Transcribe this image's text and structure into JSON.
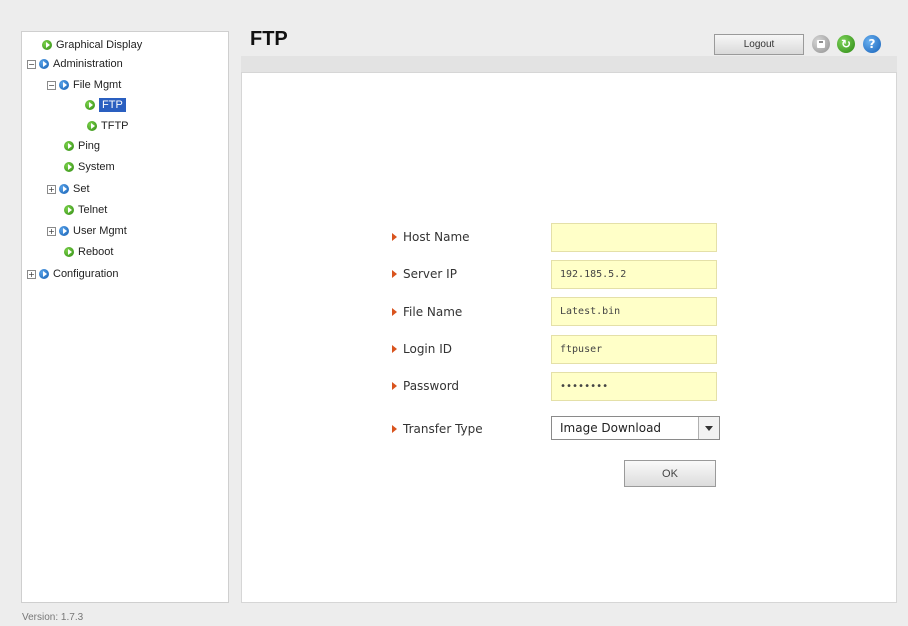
{
  "sidebar": {
    "items": [
      {
        "label": "Graphical Display",
        "toggle": "",
        "color": "green",
        "selected": false
      },
      {
        "label": "Administration",
        "toggle": "−",
        "color": "blue",
        "selected": false
      },
      {
        "label": "File Mgmt",
        "toggle": "−",
        "color": "blue",
        "selected": false
      },
      {
        "label": "FTP",
        "toggle": "",
        "color": "green",
        "selected": true
      },
      {
        "label": "TFTP",
        "toggle": "",
        "color": "green",
        "selected": false
      },
      {
        "label": "Ping",
        "toggle": "",
        "color": "green",
        "selected": false
      },
      {
        "label": "System",
        "toggle": "",
        "color": "green",
        "selected": false
      },
      {
        "label": "Set",
        "toggle": "+",
        "color": "blue",
        "selected": false
      },
      {
        "label": "Telnet",
        "toggle": "",
        "color": "green",
        "selected": false
      },
      {
        "label": "User Mgmt",
        "toggle": "+",
        "color": "blue",
        "selected": false
      },
      {
        "label": "Reboot",
        "toggle": "",
        "color": "green",
        "selected": false
      },
      {
        "label": "Configuration",
        "toggle": "+",
        "color": "blue",
        "selected": false
      }
    ]
  },
  "version": "Version: 1.7.3",
  "header": {
    "title": "FTP",
    "logout_label": "Logout",
    "icons": [
      "save-icon",
      "refresh-icon",
      "help-icon"
    ]
  },
  "form": {
    "host_name": {
      "label": "Host Name",
      "value": ""
    },
    "server_ip": {
      "label": "Server IP",
      "value": "192.185.5.2"
    },
    "file_name": {
      "label": "File Name",
      "value": "Latest.bin"
    },
    "login_id": {
      "label": "Login ID",
      "value": "ftpuser"
    },
    "password": {
      "label": "Password",
      "value": "••••••••"
    },
    "transfer_type": {
      "label": "Transfer Type",
      "value": "Image Download"
    },
    "ok_label": "OK"
  },
  "colors": {
    "accent_selected": "#2a5fc0",
    "input_background": "#ffffc8",
    "label_arrow": "#d9541e"
  }
}
